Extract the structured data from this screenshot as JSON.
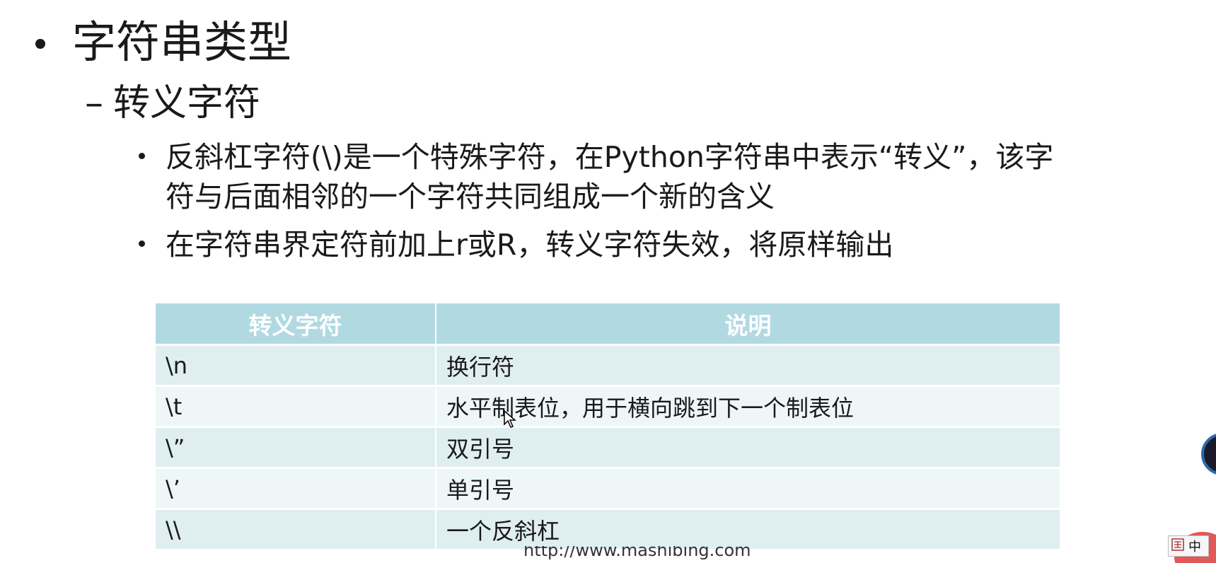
{
  "slide": {
    "heading": "字符串类型",
    "subheading": "转义字符",
    "dash": "–",
    "bullets": [
      {
        "line1": "反斜杠字符(\\)是一个特殊字符，在Python字符串中表示“转义”，该字",
        "line2": "符与后面相邻的一个字符共同组成一个新的含义"
      },
      {
        "line1": "在字符串界定符前加上r或R，转义字符失效，将原样输出"
      }
    ],
    "table": {
      "headers": [
        "转义字符",
        "说明"
      ],
      "rows": [
        [
          "\\n",
          "换行符"
        ],
        [
          "\\t",
          "水平制表位，用于横向跳到下一个制表位"
        ],
        [
          "\\”",
          "双引号"
        ],
        [
          "\\’",
          "单引号"
        ],
        [
          "\\\\",
          "一个反斜杠"
        ]
      ]
    },
    "watermark": "http://www.mashibing.com"
  },
  "colors": {
    "header_bg": "#b1d9e2",
    "row_bg": "#dfeef1",
    "row_alt_bg": "#eef6f8"
  },
  "ime": {
    "icon": "ime-grid-icon",
    "label": "中"
  }
}
